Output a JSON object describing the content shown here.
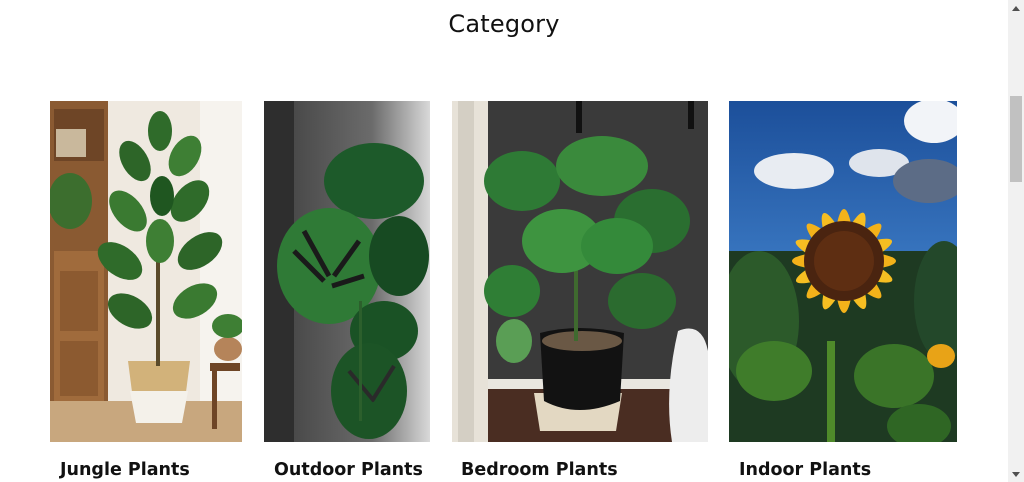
{
  "section": {
    "title": "Category"
  },
  "categories": [
    {
      "label": "Jungle Plants",
      "image": "rubber-plant-in-basket-photo"
    },
    {
      "label": "Outdoor Plants",
      "image": "monstera-leaves-photo"
    },
    {
      "label": "Bedroom Plants",
      "image": "monstera-in-black-pot-photo"
    },
    {
      "label": "Indoor Plants",
      "image": "sunflower-photo"
    }
  ],
  "scrollbar": {
    "up_icon": "arrow-up-icon",
    "down_icon": "arrow-down-icon"
  }
}
